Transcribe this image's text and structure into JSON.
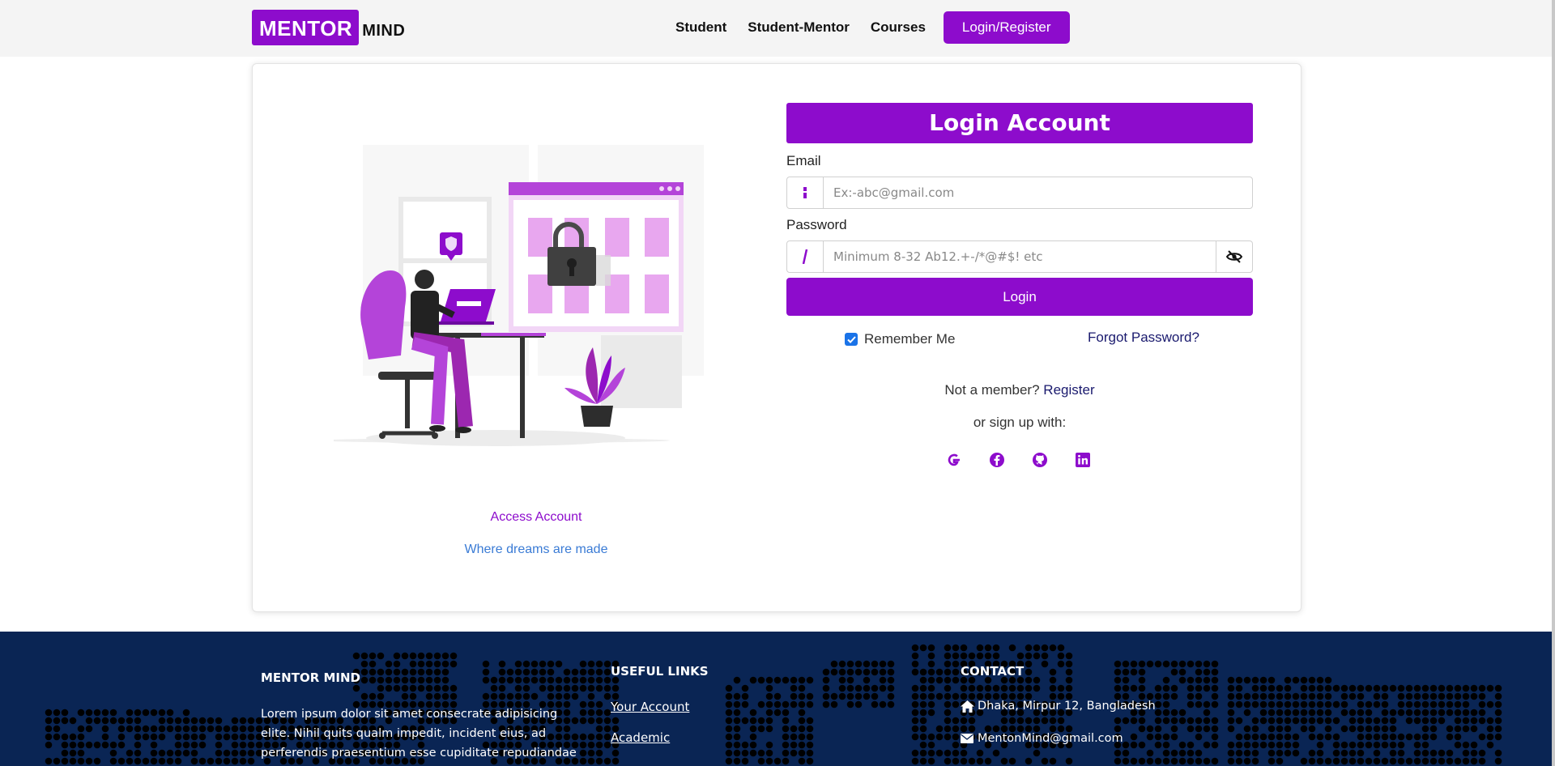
{
  "navbar": {
    "brand_box": "MENTOR",
    "brand_rest": "MIND",
    "links": [
      "Student",
      "Student-Mentor",
      "Courses"
    ],
    "cta": "Login/Register"
  },
  "left": {
    "caption1": "Access Account",
    "caption2": "Where dreams are made"
  },
  "form": {
    "title": "Login Account",
    "email_label": "Email",
    "email_placeholder": "Ex:-abc@gmail.com",
    "password_label": "Password",
    "password_placeholder": "Minimum 8-32 Ab12.+-/*@#$! etc",
    "login_button": "Login",
    "remember_me": "Remember Me",
    "remember_checked": true,
    "forgot": "Forgot Password?",
    "not_member": "Not a member?",
    "register": "Register",
    "signup_with": "or sign up with:",
    "socials": [
      "google-icon",
      "facebook-icon",
      "github-icon",
      "linkedin-icon"
    ]
  },
  "footer": {
    "col1_title": "MENTOR MIND",
    "col1_text": "Lorem ipsum dolor sit amet consecrate adipisicing elite. Nihil quits qualm impedit, incident eius, ad perferendis praesentium esse cupiditate repudiandae quos rem",
    "col2_title": "USEFUL LINKS",
    "col2_links": [
      "Your Account",
      "Academic"
    ],
    "col3_title": "CONTACT",
    "col3_address": "Dhaka, Mirpur 12, Bangladesh",
    "col3_email": "MentonMind@gmail.com"
  },
  "colors": {
    "accent": "#8d0ccc",
    "footer_bg": "#0a2554",
    "link_blue": "#3a7bd5"
  }
}
